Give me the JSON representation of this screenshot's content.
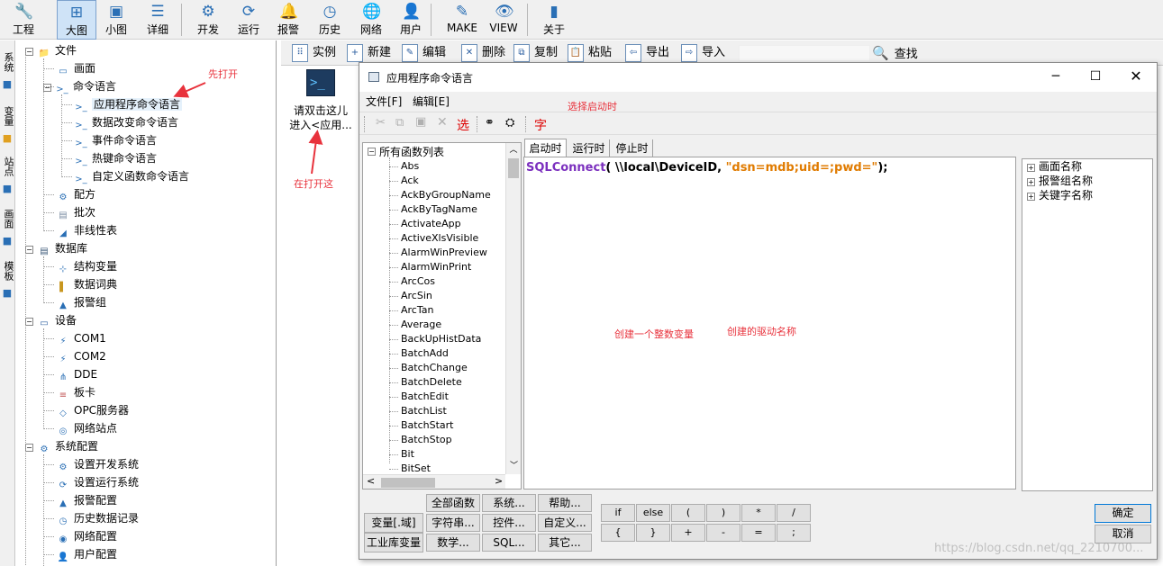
{
  "toolbar": {
    "items": [
      {
        "label": "工程",
        "icon": "wrench-icon",
        "glyph": "🔧"
      },
      {
        "label": "大图",
        "icon": "large-view-icon",
        "glyph": "⊞"
      },
      {
        "label": "小图",
        "icon": "small-view-icon",
        "glyph": "▣"
      },
      {
        "label": "详细",
        "icon": "detail-view-icon",
        "glyph": "☰"
      },
      {
        "label": "开发",
        "icon": "develop-gear-icon",
        "glyph": "⚙"
      },
      {
        "label": "运行",
        "icon": "run-icon",
        "glyph": "⟳"
      },
      {
        "label": "报警",
        "icon": "bell-icon",
        "glyph": "🔔"
      },
      {
        "label": "历史",
        "icon": "history-clock-icon",
        "glyph": "◷"
      },
      {
        "label": "网络",
        "icon": "globe-icon",
        "glyph": "🌐"
      },
      {
        "label": "用户",
        "icon": "user-icon",
        "glyph": "👤"
      },
      {
        "label": "MAKE",
        "icon": "make-icon",
        "glyph": "✎"
      },
      {
        "label": "VIEW",
        "icon": "view-eye-icon",
        "glyph": "👁"
      },
      {
        "label": "关于",
        "icon": "about-book-icon",
        "glyph": "▮"
      }
    ]
  },
  "vtabs": [
    "系统",
    "变量",
    "站点",
    "画面",
    "模板"
  ],
  "tree": [
    {
      "label": "文件",
      "level": 0,
      "pm": "−",
      "icon": "folder-icon",
      "glyph": "📁",
      "color": "#3d8fd6"
    },
    {
      "label": "画面",
      "level": 1,
      "icon": "screen-icon",
      "glyph": "▭",
      "color": "#2a6fb5"
    },
    {
      "label": "命令语言",
      "level": 1,
      "pm": "−",
      "icon": "command-icon",
      "glyph": ">_",
      "color": "#2a6fb5"
    },
    {
      "label": "应用程序命令语言",
      "level": 2,
      "icon": "command-icon",
      "glyph": ">_",
      "color": "#2a6fb5",
      "selected": true
    },
    {
      "label": "数据改变命令语言",
      "level": 2,
      "icon": "command-icon",
      "glyph": ">_",
      "color": "#2a6fb5"
    },
    {
      "label": "事件命令语言",
      "level": 2,
      "icon": "command-icon",
      "glyph": ">_",
      "color": "#2a6fb5"
    },
    {
      "label": "热键命令语言",
      "level": 2,
      "icon": "command-icon",
      "glyph": ">_",
      "color": "#2a6fb5"
    },
    {
      "label": "自定义函数命令语言",
      "level": 2,
      "icon": "command-icon",
      "glyph": ">_",
      "color": "#2a6fb5"
    },
    {
      "label": "配方",
      "level": 1,
      "icon": "recipe-icon",
      "glyph": "⚙",
      "color": "#2a6fb5"
    },
    {
      "label": "批次",
      "level": 1,
      "icon": "batch-icon",
      "glyph": "▤",
      "color": "#7b8da3"
    },
    {
      "label": "非线性表",
      "level": 1,
      "icon": "nonlinear-icon",
      "glyph": "◢",
      "color": "#2a6fb5"
    },
    {
      "label": "数据库",
      "level": 0,
      "pm": "−",
      "icon": "database-icon",
      "glyph": "▤",
      "color": "#3c5a78"
    },
    {
      "label": "结构变量",
      "level": 1,
      "icon": "struct-var-icon",
      "glyph": "⊹",
      "color": "#2a6fb5"
    },
    {
      "label": "数据词典",
      "level": 1,
      "icon": "data-dict-icon",
      "glyph": "▌",
      "color": "#c8961e"
    },
    {
      "label": "报警组",
      "level": 1,
      "icon": "alarm-group-icon",
      "glyph": "▲",
      "color": "#2a6fb5"
    },
    {
      "label": "设备",
      "level": 0,
      "pm": "−",
      "icon": "device-icon",
      "glyph": "▭",
      "color": "#2a5d9f"
    },
    {
      "label": "COM1",
      "level": 1,
      "icon": "com-port-icon",
      "glyph": "⚡",
      "color": "#2a6fb5"
    },
    {
      "label": "COM2",
      "level": 1,
      "icon": "com-port-icon",
      "glyph": "⚡",
      "color": "#2a6fb5"
    },
    {
      "label": "DDE",
      "level": 1,
      "icon": "dde-icon",
      "glyph": "⋔",
      "color": "#2a6fb5"
    },
    {
      "label": "板卡",
      "level": 1,
      "icon": "board-card-icon",
      "glyph": "≡",
      "color": "#c05050"
    },
    {
      "label": "OPC服务器",
      "level": 1,
      "icon": "opc-server-icon",
      "glyph": "◇",
      "color": "#2a6fb5"
    },
    {
      "label": "网络站点",
      "level": 1,
      "icon": "network-station-icon",
      "glyph": "◎",
      "color": "#2a6fb5"
    },
    {
      "label": "系统配置",
      "level": 0,
      "pm": "−",
      "icon": "system-config-icon",
      "glyph": "⚙",
      "color": "#2a6fb5"
    },
    {
      "label": "设置开发系统",
      "level": 1,
      "icon": "dev-settings-icon",
      "glyph": "⚙",
      "color": "#2a6fb5"
    },
    {
      "label": "设置运行系统",
      "level": 1,
      "icon": "run-settings-icon",
      "glyph": "⟳",
      "color": "#2a6fb5"
    },
    {
      "label": "报警配置",
      "level": 1,
      "icon": "alarm-config-icon",
      "glyph": "▲",
      "color": "#2a6fb5"
    },
    {
      "label": "历史数据记录",
      "level": 1,
      "icon": "history-record-icon",
      "glyph": "◷",
      "color": "#2a6fb5"
    },
    {
      "label": "网络配置",
      "level": 1,
      "icon": "network-config-icon",
      "glyph": "◉",
      "color": "#2a6fb5"
    },
    {
      "label": "用户配置",
      "level": 1,
      "icon": "user-config-icon",
      "glyph": "👤",
      "color": "#e07b00"
    }
  ],
  "rbar": {
    "items": [
      {
        "label": "实例",
        "icon": "instance-icon",
        "glyph": "⠿"
      },
      {
        "label": "新建",
        "icon": "new-doc-icon",
        "glyph": "+"
      },
      {
        "label": "编辑",
        "icon": "edit-doc-icon",
        "glyph": "✎"
      },
      {
        "label": "删除",
        "icon": "delete-doc-icon",
        "glyph": "✕"
      },
      {
        "label": "复制",
        "icon": "copy-doc-icon",
        "glyph": "⧉"
      },
      {
        "label": "粘贴",
        "icon": "paste-icon",
        "glyph": "📋"
      },
      {
        "label": "导出",
        "icon": "export-icon",
        "glyph": "⇦"
      },
      {
        "label": "导入",
        "icon": "import-icon",
        "glyph": "⇨"
      }
    ],
    "search_label": "查找",
    "search_value": ""
  },
  "content": {
    "item_label_line1": "请双击这儿",
    "item_label_line2": "进入<应用..."
  },
  "annotations": {
    "open_first": "先打开",
    "open_here": "在打开这",
    "select_startup": "选择启动时",
    "create_int_var": "创建一个整数变量",
    "driver_name": "创建的驱动名称"
  },
  "dialog": {
    "title": "应用程序命令语言",
    "menu": [
      "文件[F]",
      "编辑[E]"
    ],
    "tool_select": "选",
    "tool_char": "字",
    "func_root": "所有函数列表",
    "functions": [
      "Abs",
      "Ack",
      "AckByGroupName",
      "AckByTagName",
      "ActivateApp",
      "ActiveXlsVisible",
      "AlarmWinPreview",
      "AlarmWinPrint",
      "ArcCos",
      "ArcSin",
      "ArcTan",
      "Average",
      "BackUpHistData",
      "BatchAdd",
      "BatchChange",
      "BatchDelete",
      "BatchEdit",
      "BatchList",
      "BatchStart",
      "BatchStop",
      "Bit",
      "BitSet"
    ],
    "tabs": [
      "启动时",
      "运行时",
      "停止时"
    ],
    "code": {
      "func": "SQLConnect",
      "mid": "( \\\\local\\DeviceID, ",
      "str": "\"dsn=mdb;uid=;pwd=\"",
      "end": ");"
    },
    "right_tree": [
      "画面名称",
      "报警组名称",
      "关键字名称"
    ],
    "left_buttons": [
      "变量[.域]",
      "工业库变量"
    ],
    "func_buttons": [
      "全部函数",
      "系统...",
      "帮助...",
      "字符串...",
      "控件...",
      "自定义...",
      "数学...",
      "SQL...",
      "其它..."
    ],
    "ops": [
      "if",
      "else",
      "(",
      ")",
      "*",
      "/",
      "{",
      "}",
      "+",
      "-",
      "=",
      ";"
    ],
    "ok": "确定",
    "cancel": "取消"
  },
  "watermark": "https://blog.csdn.net/qq_2210700..."
}
